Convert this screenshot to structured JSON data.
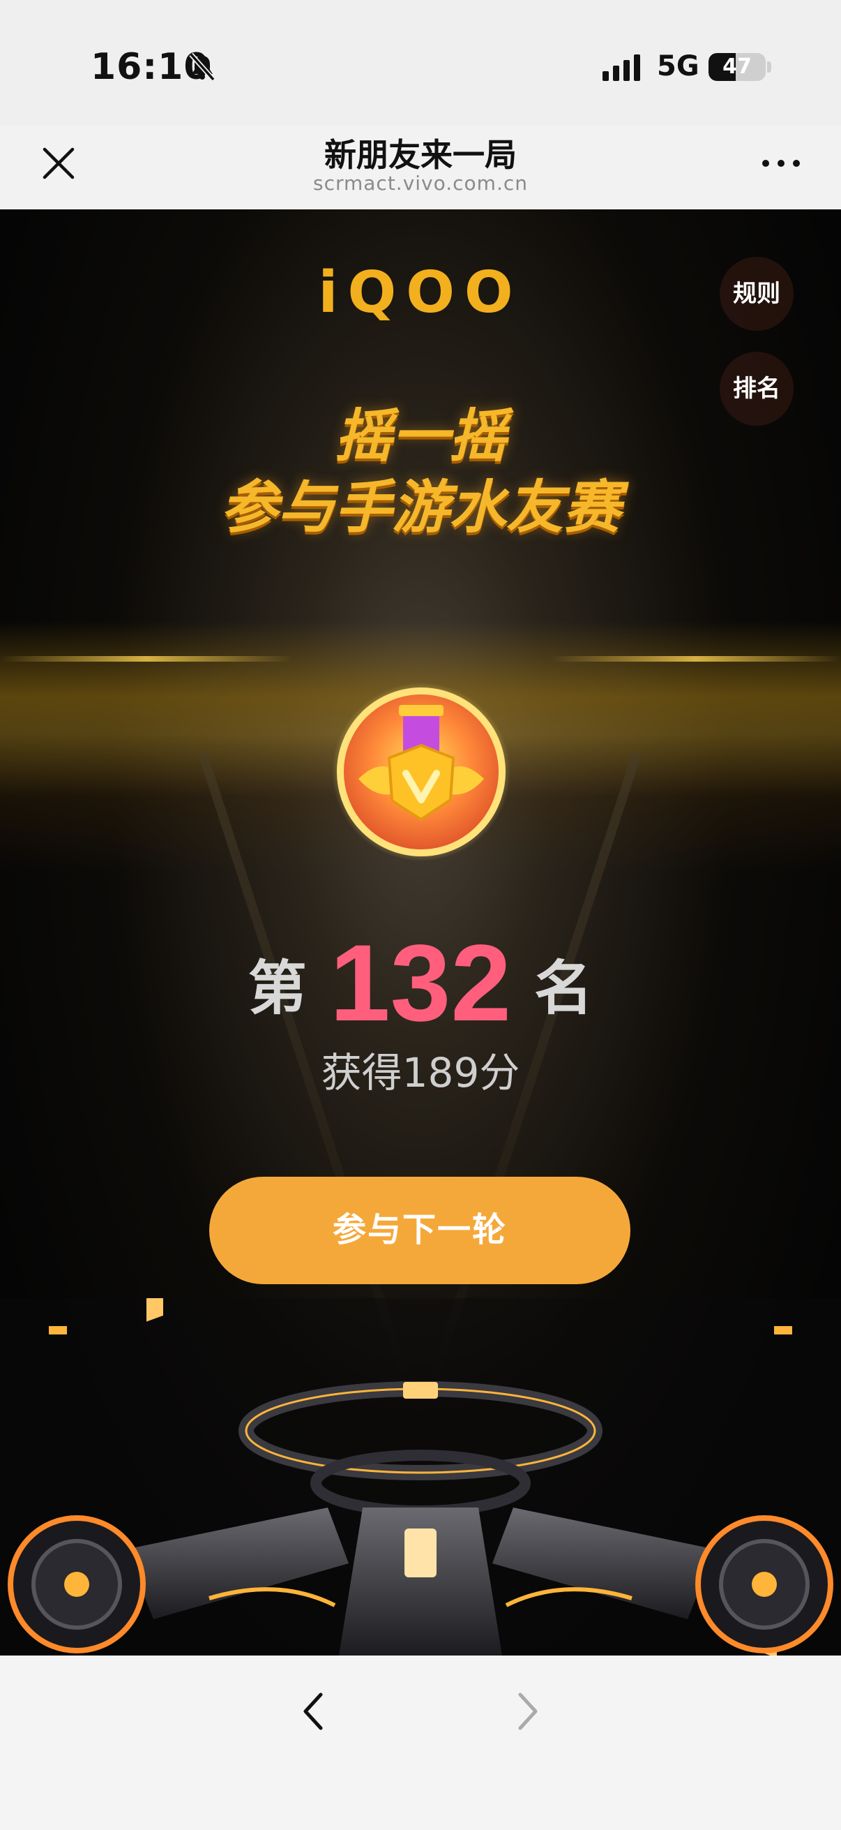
{
  "status": {
    "time": "16:10",
    "network": "5G",
    "battery_level": "47",
    "icons": [
      "bell-muted-icon",
      "signal-icon",
      "battery-icon"
    ]
  },
  "header": {
    "title": "新朋友来一局",
    "url": "scrmact.vivo.com.cn",
    "icons": [
      "close-icon",
      "more-icon"
    ]
  },
  "main": {
    "brand": "iQOO",
    "rules_label": "规则",
    "ranking_label": "排名",
    "headline_line1": "摇一摇",
    "headline_line2": "参与手游水友赛",
    "medal_icon": "medal-icon",
    "rank_prefix": "第",
    "rank_number": "132",
    "rank_suffix": "名",
    "score_text": "获得189分",
    "next_round_label": "参与下一轮"
  },
  "bottom_nav": {
    "icons": [
      "back-arrow-icon",
      "forward-arrow-icon"
    ]
  },
  "colors": {
    "accent_orange": "#f5a83a",
    "brand_gold": "#f2b01e",
    "rank_pink": "#ff5f7d"
  }
}
